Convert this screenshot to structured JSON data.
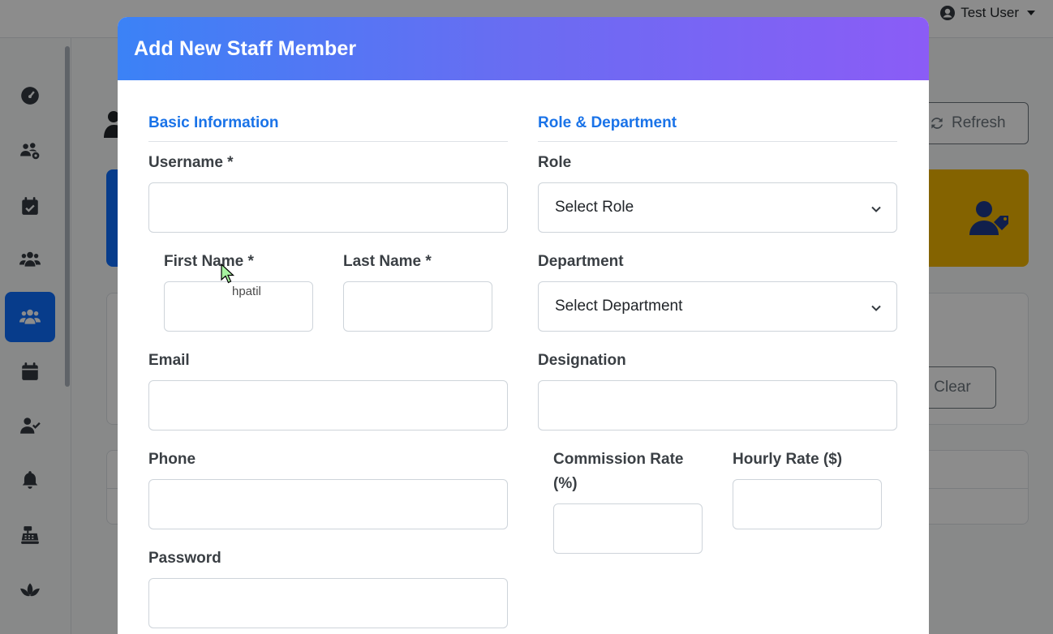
{
  "header": {
    "user_name": "Test User",
    "user_icon": "user-circle-icon"
  },
  "sidebar": {
    "items": [
      {
        "icon": "dashboard-gauge-icon",
        "active": false
      },
      {
        "icon": "users-cog-icon",
        "active": false
      },
      {
        "icon": "calendar-check-icon",
        "active": false
      },
      {
        "icon": "users-icon",
        "active": false
      },
      {
        "icon": "staff-group-icon",
        "active": true
      },
      {
        "icon": "calendar-icon",
        "active": false
      },
      {
        "icon": "user-check-icon",
        "active": false
      },
      {
        "icon": "bell-icon",
        "active": false
      },
      {
        "icon": "cash-register-icon",
        "active": false
      },
      {
        "icon": "spa-lotus-icon",
        "active": false
      }
    ]
  },
  "background": {
    "refresh_label": "Refresh",
    "clear_label": "Clear",
    "stat_card_color": "#f0b400",
    "primary_card_color": "#0d6efd"
  },
  "modal": {
    "title": "Add New Staff Member",
    "gradient_start": "#3b82f6",
    "gradient_end": "#8b5cf6",
    "basic_info": {
      "section_title": "Basic Information",
      "username_label": "Username *",
      "username_value": "",
      "first_name_label": "First Name *",
      "first_name_value": "",
      "last_name_label": "Last Name *",
      "last_name_value": "",
      "email_label": "Email",
      "email_value": "",
      "phone_label": "Phone",
      "phone_value": "",
      "password_label": "Password",
      "password_value": ""
    },
    "role_department": {
      "section_title": "Role & Department",
      "role_label": "Role",
      "role_selected": "Select Role",
      "department_label": "Department",
      "department_selected": "Select Department",
      "designation_label": "Designation",
      "designation_value": "",
      "commission_label": "Commission Rate (%)",
      "commission_value": "",
      "hourly_label": "Hourly Rate ($)",
      "hourly_value": ""
    }
  },
  "autocomplete_hint": "hpatil",
  "accent_color": "#1a73e8"
}
